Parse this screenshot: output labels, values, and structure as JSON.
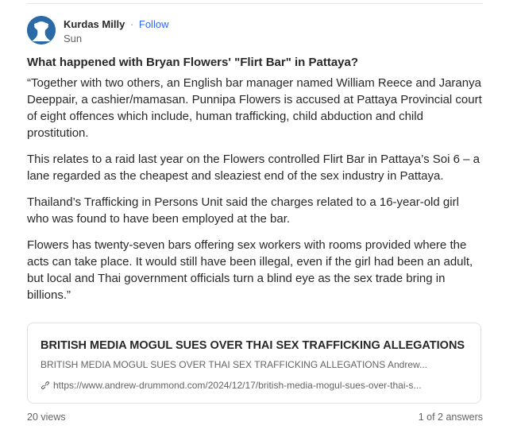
{
  "author": {
    "name": "Kurdas Milly",
    "separator": "·",
    "follow_label": "Follow",
    "time": "Sun",
    "avatar_icon": "avatar-silhouette-icon",
    "avatar_color": "#2a6aa6"
  },
  "question": {
    "title": "What happened with Bryan Flowers' \"Flirt Bar\" in Pattaya?"
  },
  "answer": {
    "paragraphs": [
      "“Together with two others, an English bar manager named William Reece and Jaranya Deeppair, a cashier/mamasan. Punnipa Flowers is accused at Pattaya Provincial court of eight offences which include, human trafficking, child abduction and child prostitution.",
      "This relates to a raid last year on the Flowers controlled Flirt Bar in Pattaya’s Soi 6 – a lane regarded as the cheapest and sleaziest end of the sex industry in Pattaya.",
      "Thailand’s Trafficking in Persons Unit said the charges related to a 16-year-old girl who was found to have been employed at the bar.",
      "Flowers has twenty-seven bars offering sex workers with rooms provided where the acts can take place. It would still have been illegal, even if the girl had been an adult, but local and Thai government officials turn a blind eye as the sex trade bring in billions.”"
    ]
  },
  "link_preview": {
    "title": "BRITISH MEDIA MOGUL SUES OVER THAI SEX TRAFFICKING ALLEGATIONS",
    "description": "BRITISH MEDIA MOGUL SUES OVER THAI SEX TRAFFICKING ALLEGATIONS Andrew...",
    "url": "https://www.andrew-drummond.com/2024/12/17/british-media-mogul-sues-over-thai-s...",
    "icon": "link-icon"
  },
  "footer": {
    "views": "20 views",
    "answer_position": "1 of 2 answers"
  },
  "colors": {
    "accent": "#2e69ff",
    "text": "#282829",
    "muted": "#636466"
  }
}
